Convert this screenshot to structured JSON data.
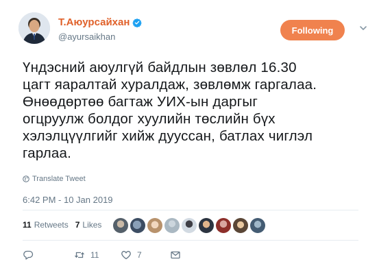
{
  "user": {
    "display_name": "Т.Аюурсайхан",
    "handle": "@ayursaikhan",
    "verified_icon": "verified-badge-icon",
    "avatar_icon": "avatar"
  },
  "follow_button": {
    "label": "Following"
  },
  "tweet": {
    "lines": [
      "Үндэсний аюулгүй байдлын зөвлөл 16.30",
      "цагт яаралтай хуралдаж, зөвлөмж гаргалаа.",
      "Өнөөдөртөө багтаж УИХ-ын даргыг",
      "огцруулж болдог хуулийн төслийн бүх",
      "хэлэлцүүлгийг хийж дууссан, батлах чиглэл",
      "гарлаа."
    ],
    "translate_label": "Translate Tweet",
    "timestamp": "6:42 PM - 10 Jan 2019"
  },
  "stats": {
    "retweets_count": "11",
    "retweets_label": "Retweets",
    "likes_count": "7",
    "likes_label": "Likes"
  },
  "actions": {
    "reply_icon": "reply-icon",
    "retweet_icon": "retweet-icon",
    "retweet_count": "11",
    "like_icon": "heart-icon",
    "like_count": "7",
    "dm_icon": "envelope-icon"
  },
  "colors": {
    "accent": "#f0824e",
    "name": "#e0612a",
    "muted": "#657786",
    "text": "#14171a",
    "verified": "#1da1f2"
  }
}
